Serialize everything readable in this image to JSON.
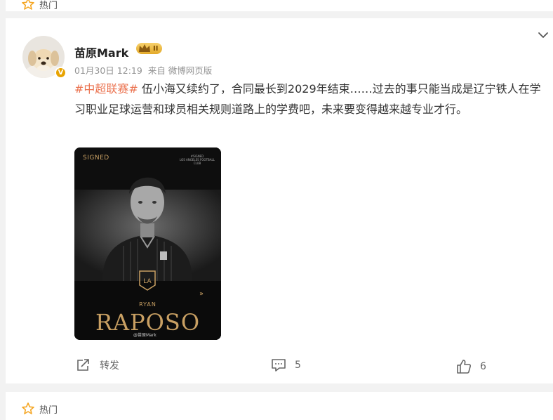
{
  "top_card": {
    "hot_label": "热门"
  },
  "post": {
    "username": "苗原Mark",
    "level": "II",
    "vip_mark": "V",
    "date": "01月30日 12:19",
    "source": "来自 微博网页版",
    "hashtag": "#中超联赛#",
    "body_text": " 伍小海又续约了，合同最长到2029年结束……过去的事只能当成是辽宁铁人在学习职业足球运营和球员相关规则道路上的学费吧，未来要变得越来越专业才行。",
    "image": {
      "signed": "SIGNED",
      "club_line1": "#SIGNED",
      "club_line2": "LOS ANGELES FOOTBALL CLUB",
      "first_name": "RYAN",
      "last_name": "RAPOSO",
      "watermark": "@苗原Mark"
    },
    "actions": {
      "repost_label": "转发",
      "comment_count": "5",
      "like_count": "6"
    }
  },
  "bottom_card": {
    "hot_label": "热门"
  },
  "colors": {
    "hashtag": "#eb7350",
    "gold": "#c9a063",
    "vip_badge": "#e8a300"
  }
}
